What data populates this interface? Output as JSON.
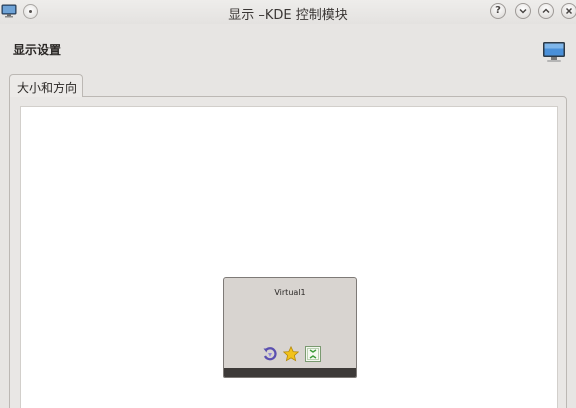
{
  "window": {
    "title": "显示 –KDE 控制模块",
    "buttons": {
      "help": "?",
      "minimize": "minimize",
      "maximize": "maximize",
      "close": "close"
    }
  },
  "header": {
    "title": "显示设置",
    "icon": "monitor-icon"
  },
  "tabs": [
    {
      "label": "大小和方向",
      "active": true
    }
  ],
  "outputs": [
    {
      "name": "Virtual1",
      "icons": [
        "rotate-icon",
        "primary-star-icon",
        "resize-icon"
      ]
    }
  ],
  "colors": {
    "accent": "#7b6fc9",
    "star": "#f2c21a",
    "resize": "#3d9b3a",
    "footer": "#3d3a38"
  }
}
